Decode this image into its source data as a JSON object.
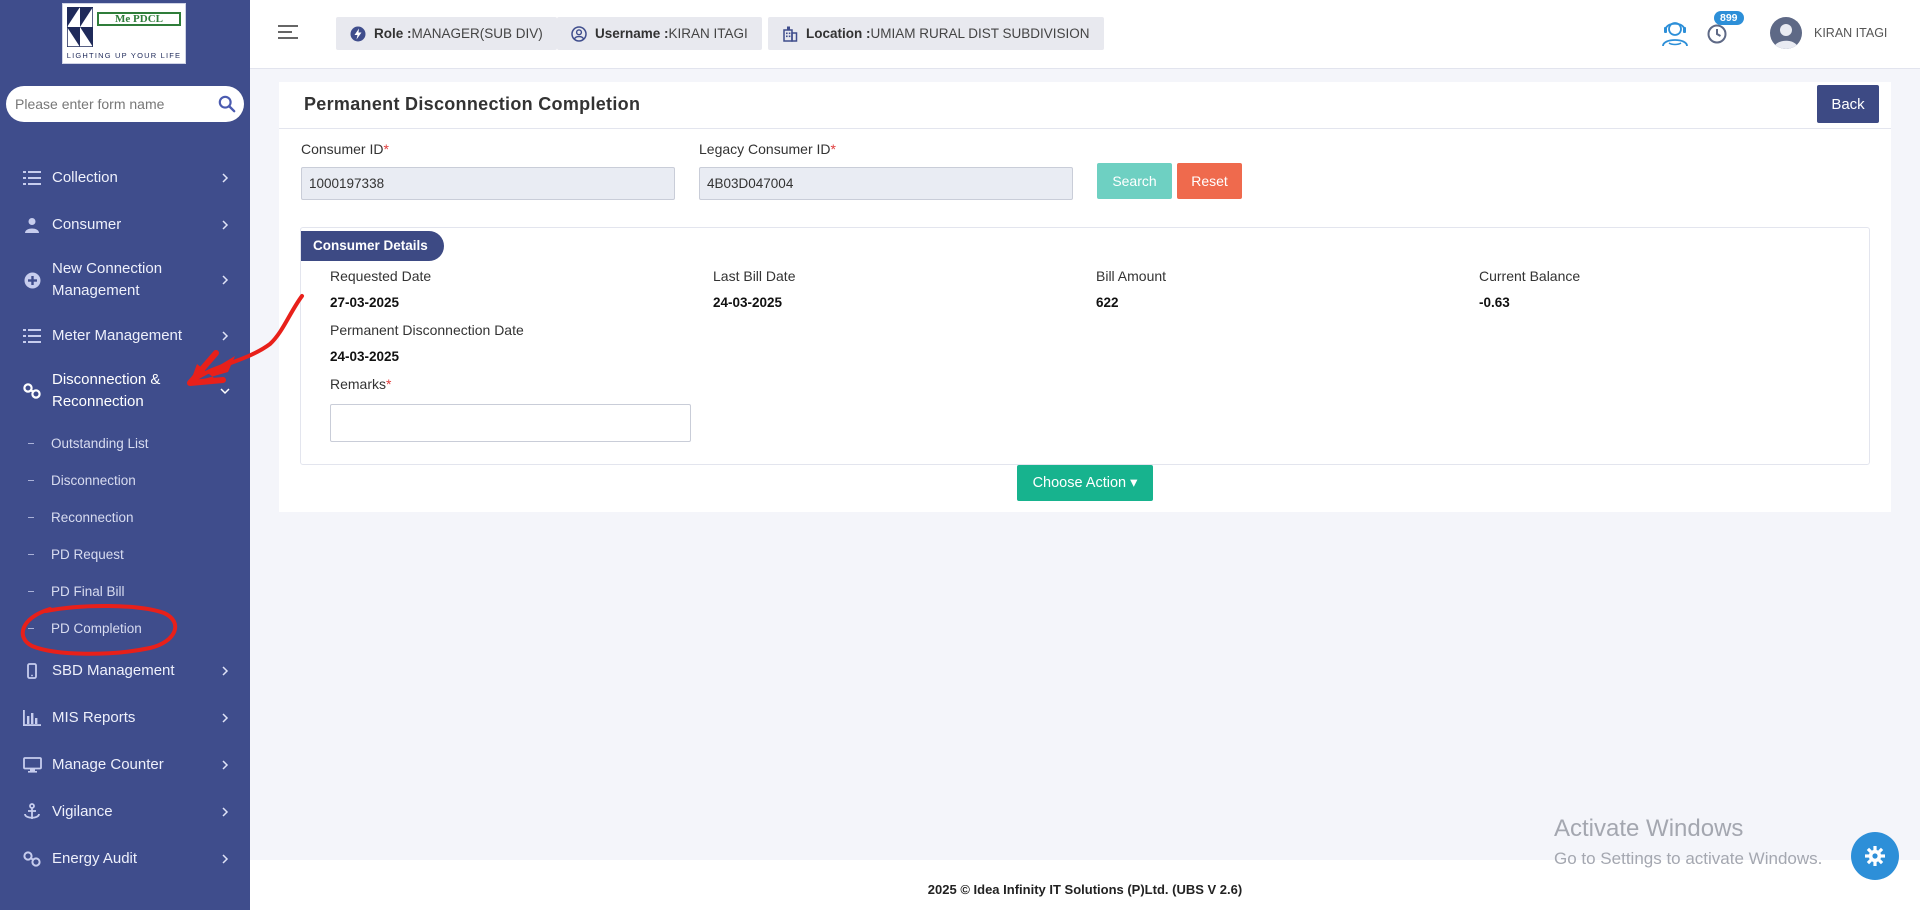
{
  "sidebar": {
    "logo_text": "Me PDCL",
    "logo_tagline": "LIGHTING UP YOUR LIFE",
    "search_placeholder": "Please enter form name",
    "items": [
      {
        "label": "Collection",
        "icon": "list-icon"
      },
      {
        "label": "Consumer",
        "icon": "user-icon"
      },
      {
        "label": "New Connection Management",
        "icon": "plus-circle-icon"
      },
      {
        "label": "Meter Management",
        "icon": "list-icon"
      },
      {
        "label": "Disconnection & Reconnection",
        "icon": "link-icon"
      },
      {
        "label": "SBD Management",
        "icon": "mobile-icon"
      },
      {
        "label": "MIS Reports",
        "icon": "bar-chart-icon"
      },
      {
        "label": "Manage Counter",
        "icon": "monitor-icon"
      },
      {
        "label": "Vigilance",
        "icon": "anchor-icon"
      },
      {
        "label": "Energy Audit",
        "icon": "link-icon"
      }
    ],
    "sub_items": [
      "Outstanding List",
      "Disconnection",
      "Reconnection",
      "PD Request",
      "PD Final Bill",
      "PD Completion"
    ]
  },
  "header": {
    "role_label": "Role :",
    "role_value": "MANAGER(SUB DIV)",
    "username_label": "Username :",
    "username_value": "KIRAN ITAGI",
    "location_label": "Location :",
    "location_value": "UMIAM RURAL DIST SUBDIVISION",
    "notification_count": "899",
    "user_name": "KIRAN ITAGI"
  },
  "page": {
    "title": "Permanent Disconnection Completion",
    "back_label": "Back",
    "consumer_id_label": "Consumer ID",
    "consumer_id_value": "1000197338",
    "legacy_id_label": "Legacy Consumer ID",
    "legacy_id_value": "4B03D047004",
    "required_mark": "*",
    "search_label": "Search",
    "reset_label": "Reset",
    "details_title": "Consumer Details",
    "requested_date_label": "Requested Date",
    "requested_date_value": "27-03-2025",
    "last_bill_date_label": "Last Bill Date",
    "last_bill_date_value": "24-03-2025",
    "bill_amount_label": "Bill Amount",
    "bill_amount_value": "622",
    "current_balance_label": "Current Balance",
    "current_balance_value": "-0.63",
    "pd_date_label": "Permanent Disconnection Date",
    "pd_date_value": "24-03-2025",
    "remarks_label": "Remarks",
    "remarks_value": "",
    "choose_action_label": "Choose Action ▾"
  },
  "footer": {
    "text": "2025 © Idea Infinity IT Solutions (P)Ltd. (UBS V 2.6)"
  },
  "watermark": {
    "line1": "Activate Windows",
    "line2": "Go to Settings to activate Windows."
  },
  "colors": {
    "sidebar_bg": "#3f4d8c",
    "primary": "#3d4a84",
    "search_btn": "#6ed0c2",
    "reset_btn": "#ef6a4d",
    "action_btn": "#17b38e",
    "annotation": "#e8201a"
  }
}
